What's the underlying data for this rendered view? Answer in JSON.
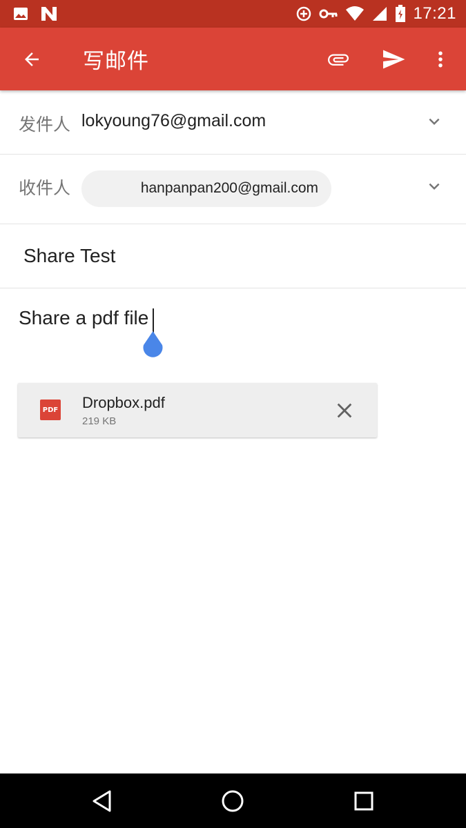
{
  "status_bar": {
    "time": "17:21",
    "icons": [
      "image-icon",
      "notification-n-icon",
      "data-saver-icon",
      "vpn-key-icon",
      "wifi-icon",
      "signal-icon",
      "battery-icon"
    ]
  },
  "app_bar": {
    "title": "写邮件",
    "icons": [
      "back-arrow-icon",
      "attach-icon",
      "send-icon",
      "more-vert-icon"
    ],
    "color": "#db4437"
  },
  "compose": {
    "from_label": "发件人",
    "from_value": "lokyoung76@gmail.com",
    "to_label": "收件人",
    "to_chip": "hanpanpan200@gmail.com",
    "subject": "Share Test",
    "body": "Share a pdf file"
  },
  "attachment": {
    "icon_text": "PDF",
    "name": "Dropbox.pdf",
    "size": "219 KB"
  },
  "nav_bar": {
    "icons": [
      "back-triangle-icon",
      "home-circle-icon",
      "recents-square-icon"
    ]
  }
}
